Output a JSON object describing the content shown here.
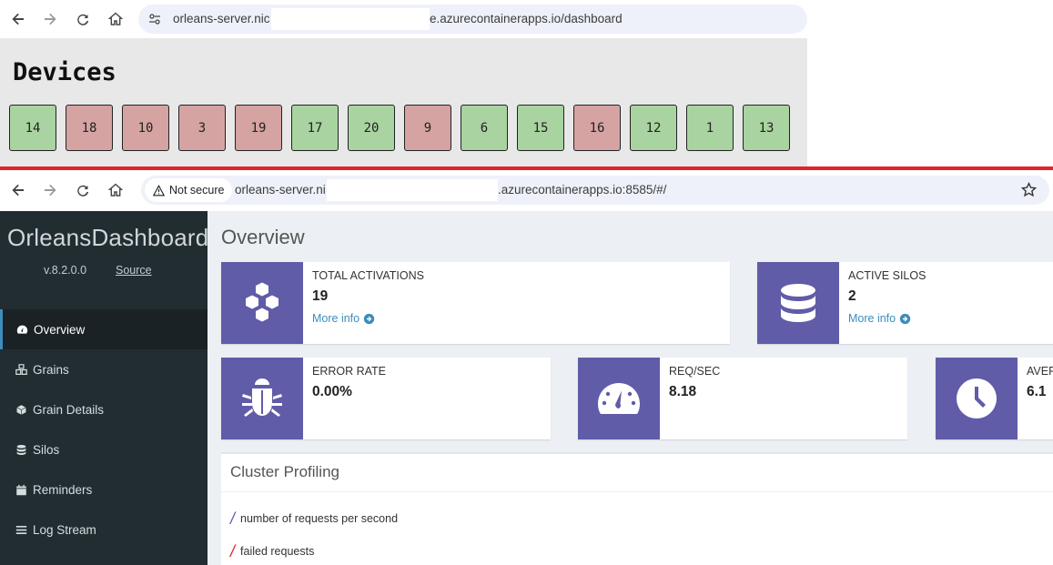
{
  "top_browser": {
    "url_left": "orleans-server.nic",
    "url_right": "e.azurecontainerapps.io/dashboard",
    "page_title": "Devices",
    "devices": [
      {
        "label": "14",
        "state": "on"
      },
      {
        "label": "18",
        "state": "off"
      },
      {
        "label": "10",
        "state": "off"
      },
      {
        "label": "3",
        "state": "off"
      },
      {
        "label": "19",
        "state": "off"
      },
      {
        "label": "17",
        "state": "on"
      },
      {
        "label": "20",
        "state": "on"
      },
      {
        "label": "9",
        "state": "off"
      },
      {
        "label": "6",
        "state": "on"
      },
      {
        "label": "15",
        "state": "on"
      },
      {
        "label": "16",
        "state": "off"
      },
      {
        "label": "12",
        "state": "on"
      },
      {
        "label": "1",
        "state": "on"
      },
      {
        "label": "13",
        "state": "on"
      }
    ],
    "colors": {
      "on": "#a9d3a0",
      "off": "#d6a3a3"
    }
  },
  "bottom_browser": {
    "security_label": "Not secure",
    "url_left": "orleans-server.ni",
    "url_right": ".azurecontainerapps.io:8585/#/"
  },
  "sidebar": {
    "brand": "OrleansDashboard",
    "version": "v.8.2.0.0",
    "source_label": "Source",
    "items": [
      {
        "label": "Overview",
        "icon": "dashboard-icon",
        "active": true
      },
      {
        "label": "Grains",
        "icon": "cubes-icon",
        "active": false
      },
      {
        "label": "Grain Details",
        "icon": "cube-icon",
        "active": false
      },
      {
        "label": "Silos",
        "icon": "database-icon",
        "active": false
      },
      {
        "label": "Reminders",
        "icon": "calendar-icon",
        "active": false
      },
      {
        "label": "Log Stream",
        "icon": "bars-icon",
        "active": false
      }
    ]
  },
  "main": {
    "title": "Overview",
    "cards": {
      "total_activations": {
        "label": "TOTAL ACTIVATIONS",
        "value": "19",
        "more": "More info",
        "icon": "cubes-icon"
      },
      "active_silos": {
        "label": "ACTIVE SILOS",
        "value": "2",
        "more": "More info",
        "icon": "database-icon"
      },
      "error_rate": {
        "label": "ERROR RATE",
        "value": "0.00%",
        "icon": "bug-icon"
      },
      "req_sec": {
        "label": "REQ/SEC",
        "value": "8.18",
        "icon": "gauge-icon"
      },
      "average": {
        "label": "AVER",
        "value": "6.1",
        "icon": "clock-icon"
      }
    },
    "profiling": {
      "title": "Cluster Profiling",
      "legend": [
        {
          "label": "number of requests per second",
          "color": "#605ca8"
        },
        {
          "label": "failed requests",
          "color": "#e0242a"
        }
      ]
    }
  },
  "colors": {
    "accent": "#605ca8",
    "link": "#3c8dbc",
    "sidebar": "#222d32",
    "divider": "#e0242a"
  }
}
